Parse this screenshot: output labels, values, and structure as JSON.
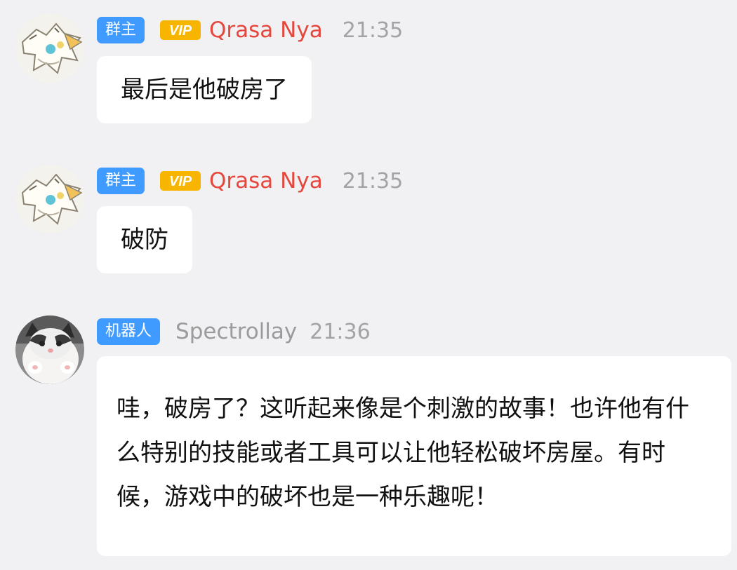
{
  "messages": [
    {
      "role_badge": "群主",
      "vip_badge": "VIP",
      "sender": "Qrasa Nya",
      "time": "21:35",
      "text": "最后是他破房了",
      "avatar_icon": "fox-character-avatar"
    },
    {
      "role_badge": "群主",
      "vip_badge": "VIP",
      "sender": "Qrasa Nya",
      "time": "21:35",
      "text": "破防",
      "avatar_icon": "fox-character-avatar"
    },
    {
      "role_badge": "机器人",
      "sender": "Spectrollay",
      "time": "21:36",
      "text": "哇，破房了？这听起来像是个刺激的故事！也许他有什么特别的技能或者工具可以让他轻松破坏房屋。有时候，游戏中的破坏也是一种乐趣呢！",
      "avatar_icon": "kitten-avatar"
    }
  ],
  "colors": {
    "role_badge_bg": "#3f9bff",
    "vip_badge_bg": "#f7b500",
    "vip_name": "#e5473d",
    "plain_name": "#9b9b9b",
    "timestamp": "#a3a3a3",
    "bubble_bg": "#ffffff",
    "background": "#f1f1f3"
  }
}
